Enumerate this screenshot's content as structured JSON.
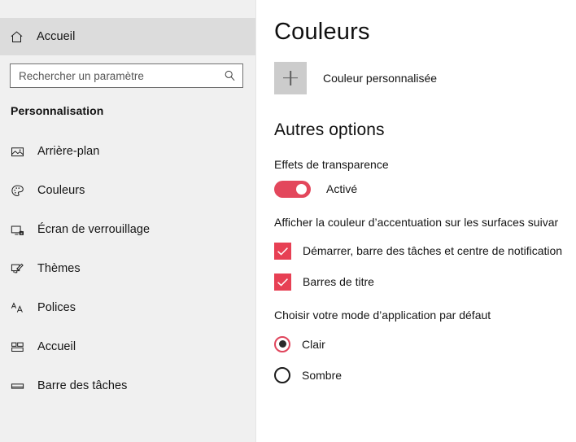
{
  "theme": {
    "accent_color": "#e74054",
    "toggle_on_color": "#e3475c",
    "checkbox_color": "#e74054",
    "radio_ring_color": "#e0455c",
    "sidebar_bg": "#f0f0f0",
    "sidebar_highlight_bg": "#dcdcdc",
    "content_bg": "#ffffff",
    "swatch_bg": "#cccccc"
  },
  "sidebar": {
    "home": {
      "label": "Accueil",
      "icon": "home-icon"
    },
    "search": {
      "placeholder": "Rechercher un paramètre",
      "value": "",
      "icon": "search-icon"
    },
    "section_title": "Personnalisation",
    "items": [
      {
        "label": "Arrière-plan",
        "icon": "picture-icon"
      },
      {
        "label": "Couleurs",
        "icon": "palette-icon"
      },
      {
        "label": "Écran de verrouillage",
        "icon": "lock-screen-icon"
      },
      {
        "label": "Thèmes",
        "icon": "theme-brush-icon"
      },
      {
        "label": "Polices",
        "icon": "fonts-aa-icon"
      },
      {
        "label": "Accueil",
        "icon": "start-tiles-icon"
      },
      {
        "label": "Barre des tâches",
        "icon": "taskbar-icon"
      }
    ]
  },
  "content": {
    "page_title": "Couleurs",
    "custom_color": {
      "label": "Couleur personnalisée",
      "button_icon": "plus-icon"
    },
    "other_options": {
      "heading": "Autres options",
      "transparency": {
        "label": "Effets de transparence",
        "state_label": "Activé",
        "checked": true
      },
      "accent_surfaces": {
        "label": "Afficher la couleur d’accentuation sur les surfaces suivar",
        "checkboxes": [
          {
            "label": "Démarrer, barre des tâches et centre de notification",
            "checked": true
          },
          {
            "label": "Barres de titre",
            "checked": true
          }
        ]
      },
      "app_mode": {
        "label": "Choisir votre mode d’application par défaut",
        "options": [
          {
            "label": "Clair",
            "checked": true
          },
          {
            "label": "Sombre",
            "checked": false
          }
        ]
      }
    }
  }
}
